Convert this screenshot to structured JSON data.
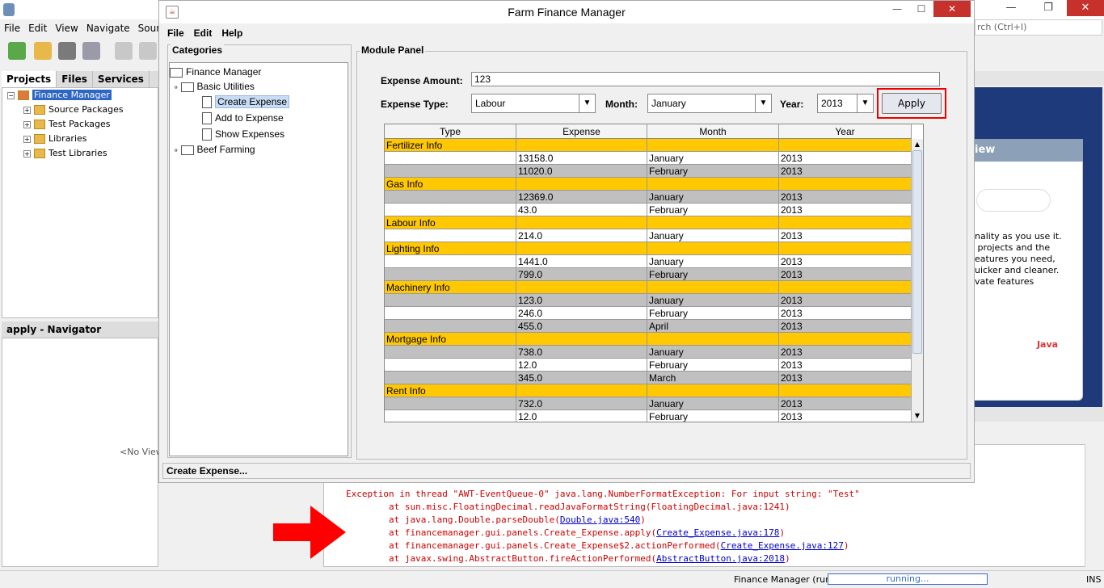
{
  "ide": {
    "menu": [
      "File",
      "Edit",
      "View",
      "Navigate",
      "Source"
    ],
    "search_placeholder": "rch (Ctrl+I)",
    "project_tabs": [
      "Projects",
      "Files",
      "Services"
    ],
    "project_tree": {
      "root": "Finance Manager",
      "children": [
        "Source Packages",
        "Test Packages",
        "Libraries",
        "Test Libraries"
      ]
    },
    "navigator_title": "apply - Navigator",
    "navigator_empty": "<No View",
    "start_page_heading": "iew",
    "start_page_text": "nality as you use it.\n projects and the\neatures you need,\nuicker and cleaner.\nvate features",
    "java_logo": "Java",
    "output_lines": [
      {
        "text": "Exception in thread \"AWT-EventQueue-0\" java.lang.NumberFormatException: For input string: \"Test\"",
        "link": ""
      },
      {
        "text": "        at sun.misc.FloatingDecimal.readJavaFormatString(FloatingDecimal.java:1241)",
        "link": ""
      },
      {
        "text": "        at java.lang.Double.parseDouble(",
        "link": "Double.java:540",
        "tail": ")"
      },
      {
        "text": "        at financemanager.gui.panels.Create_Expense.apply(",
        "link": "Create_Expense.java:178",
        "tail": ")"
      },
      {
        "text": "        at financemanager.gui.panels.Create_Expense$2.actionPerformed(",
        "link": "Create_Expense.java:127",
        "tail": ")"
      },
      {
        "text": "        at javax.swing.AbstractButton.fireActionPerformed(",
        "link": "AbstractButton.java:2018",
        "tail": ")"
      }
    ],
    "status_project": "Finance Manager (run)",
    "status_progress": "running...",
    "status_mode": "INS"
  },
  "app": {
    "title": "Farm Finance Manager",
    "menu": [
      "File",
      "Edit",
      "Help"
    ],
    "categories_label": "Categories",
    "tree": {
      "root": "Finance Manager",
      "basic": "Basic Utilities",
      "items": [
        "Create Expense",
        "Add to Expense",
        "Show Expenses"
      ],
      "beef": "Beef Farming"
    },
    "module_label": "Module Panel",
    "form": {
      "amount_label": "Expense Amount:",
      "amount_value": "123",
      "type_label": "Expense Type:",
      "type_value": "Labour",
      "month_label": "Month:",
      "month_value": "January",
      "year_label": "Year:",
      "year_value": "2013",
      "apply_label": "Apply"
    },
    "table": {
      "columns": [
        "Type",
        "Expense",
        "Month",
        "Year"
      ],
      "rows": [
        {
          "kind": "cat",
          "cells": [
            "Fertilizer Info",
            "",
            "",
            ""
          ]
        },
        {
          "kind": "white",
          "cells": [
            "",
            "13158.0",
            "January",
            "2013"
          ]
        },
        {
          "kind": "gray",
          "cells": [
            "",
            "11020.0",
            "February",
            "2013"
          ]
        },
        {
          "kind": "cat",
          "cells": [
            "Gas Info",
            "",
            "",
            ""
          ]
        },
        {
          "kind": "gray",
          "cells": [
            "",
            "12369.0",
            "January",
            "2013"
          ]
        },
        {
          "kind": "white",
          "cells": [
            "",
            "43.0",
            "February",
            "2013"
          ]
        },
        {
          "kind": "cat",
          "cells": [
            "Labour Info",
            "",
            "",
            ""
          ]
        },
        {
          "kind": "white",
          "cells": [
            "",
            "214.0",
            "January",
            "2013"
          ]
        },
        {
          "kind": "cat",
          "cells": [
            "Lighting Info",
            "",
            "",
            ""
          ]
        },
        {
          "kind": "white",
          "cells": [
            "",
            "1441.0",
            "January",
            "2013"
          ]
        },
        {
          "kind": "gray",
          "cells": [
            "",
            "799.0",
            "February",
            "2013"
          ]
        },
        {
          "kind": "cat",
          "cells": [
            "Machinery Info",
            "",
            "",
            ""
          ]
        },
        {
          "kind": "gray",
          "cells": [
            "",
            "123.0",
            "January",
            "2013"
          ]
        },
        {
          "kind": "white",
          "cells": [
            "",
            "246.0",
            "February",
            "2013"
          ]
        },
        {
          "kind": "gray",
          "cells": [
            "",
            "455.0",
            "April",
            "2013"
          ]
        },
        {
          "kind": "cat",
          "cells": [
            "Mortgage Info",
            "",
            "",
            ""
          ]
        },
        {
          "kind": "gray",
          "cells": [
            "",
            "738.0",
            "January",
            "2013"
          ]
        },
        {
          "kind": "white",
          "cells": [
            "",
            "12.0",
            "February",
            "2013"
          ]
        },
        {
          "kind": "gray",
          "cells": [
            "",
            "345.0",
            "March",
            "2013"
          ]
        },
        {
          "kind": "cat",
          "cells": [
            "Rent Info",
            "",
            "",
            ""
          ]
        },
        {
          "kind": "gray",
          "cells": [
            "",
            "732.0",
            "January",
            "2013"
          ]
        },
        {
          "kind": "white",
          "cells": [
            "",
            "12.0",
            "February",
            "2013"
          ]
        }
      ]
    },
    "status": "Create Expense..."
  },
  "colors": {
    "category_row": "#ffc800",
    "gray_row": "#c0c0c0",
    "highlight": "#e00000"
  }
}
